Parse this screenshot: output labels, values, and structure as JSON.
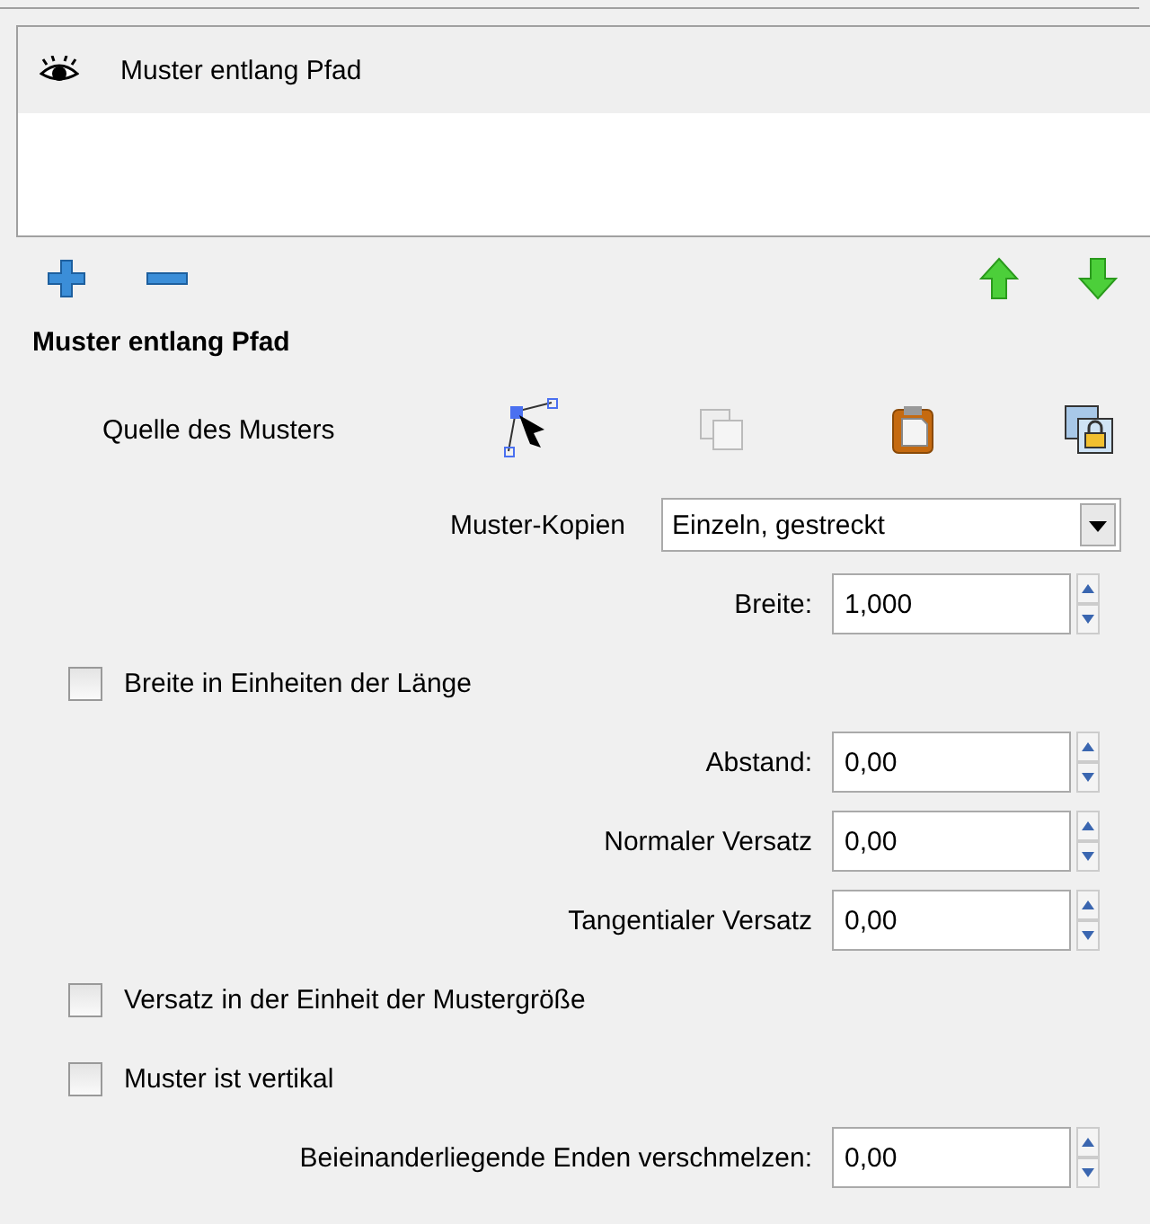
{
  "effects_list": {
    "items": [
      {
        "name": "Muster entlang Pfad",
        "visible": true
      }
    ]
  },
  "section_title": "Muster entlang Pfad",
  "rows": [
    {
      "kind": "source",
      "label": "Quelle des Musters"
    },
    {
      "kind": "combo",
      "label": "Muster-Kopien",
      "value": "Einzeln, gestreckt"
    },
    {
      "kind": "spin",
      "label": "Breite:",
      "value": "1,000"
    },
    {
      "kind": "check",
      "label": "Breite in Einheiten der Länge",
      "checked": false
    },
    {
      "kind": "spin",
      "label": "Abstand:",
      "value": "0,00"
    },
    {
      "kind": "spin",
      "label": "Normaler Versatz",
      "value": "0,00"
    },
    {
      "kind": "spin",
      "label": "Tangentialer Versatz",
      "value": "0,00"
    },
    {
      "kind": "check",
      "label": "Versatz in der Einheit der Mustergröße",
      "checked": false
    },
    {
      "kind": "check",
      "label": "Muster ist vertikal",
      "checked": false
    },
    {
      "kind": "spin",
      "label": "Beieinanderliegende Enden verschmelzen:",
      "value": "0,00"
    }
  ]
}
